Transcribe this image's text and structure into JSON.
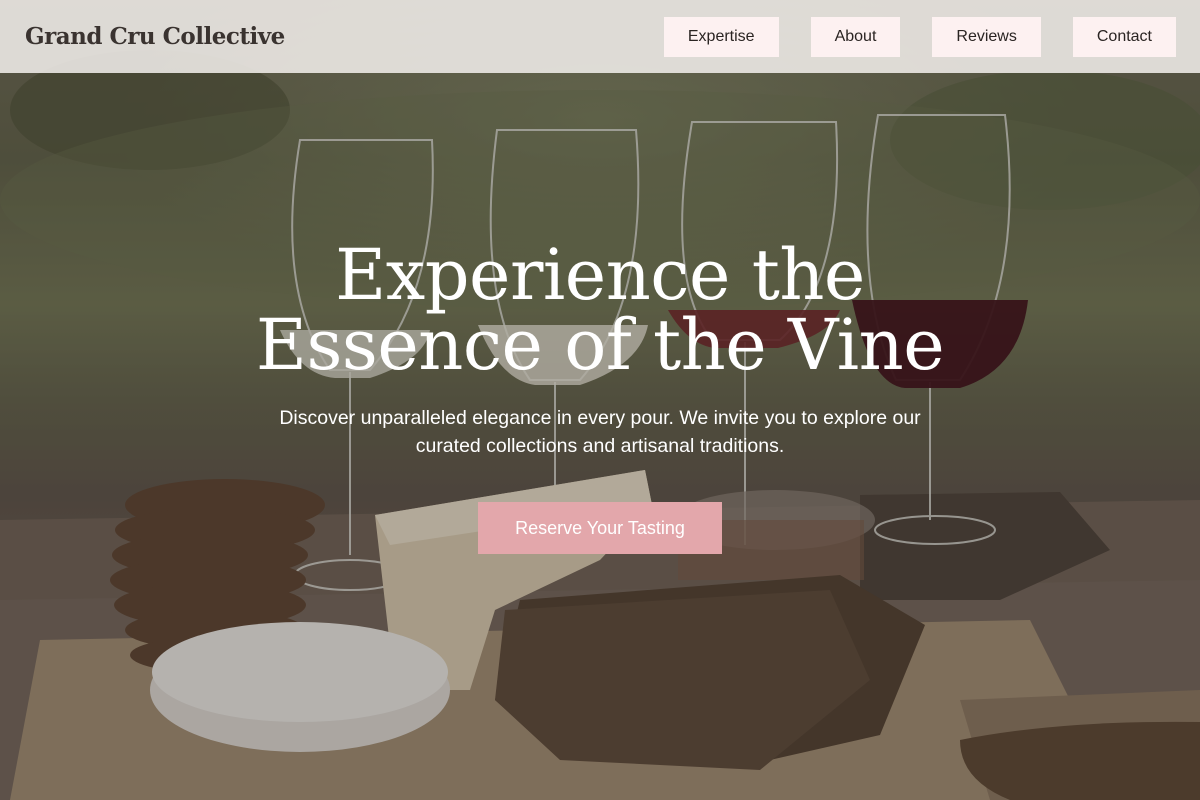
{
  "brand": {
    "name": "Grand Cru Collective"
  },
  "nav": {
    "items": [
      {
        "label": "Expertise"
      },
      {
        "label": "About"
      },
      {
        "label": "Reviews"
      },
      {
        "label": "Contact"
      }
    ]
  },
  "hero": {
    "headline": "Experience the Essence of the Vine",
    "subtext": "Discover unparalleled elegance in every pour. We invite you to explore our curated collections and artisanal traditions.",
    "cta_label": "Reserve Your Tasting",
    "background_image": "wine-tasting-cheese-board-photo"
  },
  "colors": {
    "accent": "#e3a7ab",
    "nav_button_bg": "#fdf1f1",
    "header_bg": "#f0ede9",
    "logo_text": "#3a3330",
    "hero_text": "#ffffff"
  }
}
